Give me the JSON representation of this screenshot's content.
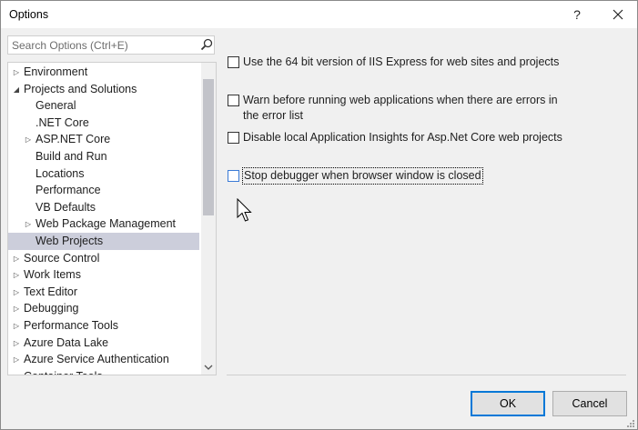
{
  "window": {
    "title": "Options",
    "help_label": "?"
  },
  "search": {
    "placeholder": "Search Options (Ctrl+E)"
  },
  "tree": {
    "items": [
      {
        "label": "Environment",
        "expander": "collapsed",
        "level": 0,
        "selected": false
      },
      {
        "label": "Projects and Solutions",
        "expander": "expanded",
        "level": 0,
        "selected": false
      },
      {
        "label": "General",
        "expander": "none",
        "level": 1,
        "selected": false
      },
      {
        "label": ".NET Core",
        "expander": "none",
        "level": 1,
        "selected": false
      },
      {
        "label": "ASP.NET Core",
        "expander": "collapsed",
        "level": 1,
        "selected": false
      },
      {
        "label": "Build and Run",
        "expander": "none",
        "level": 1,
        "selected": false
      },
      {
        "label": "Locations",
        "expander": "none",
        "level": 1,
        "selected": false
      },
      {
        "label": "Performance",
        "expander": "none",
        "level": 1,
        "selected": false
      },
      {
        "label": "VB Defaults",
        "expander": "none",
        "level": 1,
        "selected": false
      },
      {
        "label": "Web Package Management",
        "expander": "collapsed",
        "level": 1,
        "selected": false
      },
      {
        "label": "Web Projects",
        "expander": "none",
        "level": 1,
        "selected": true
      },
      {
        "label": "Source Control",
        "expander": "collapsed",
        "level": 0,
        "selected": false
      },
      {
        "label": "Work Items",
        "expander": "collapsed",
        "level": 0,
        "selected": false
      },
      {
        "label": "Text Editor",
        "expander": "collapsed",
        "level": 0,
        "selected": false
      },
      {
        "label": "Debugging",
        "expander": "collapsed",
        "level": 0,
        "selected": false
      },
      {
        "label": "Performance Tools",
        "expander": "collapsed",
        "level": 0,
        "selected": false
      },
      {
        "label": "Azure Data Lake",
        "expander": "collapsed",
        "level": 0,
        "selected": false
      },
      {
        "label": "Azure Service Authentication",
        "expander": "collapsed",
        "level": 0,
        "selected": false
      },
      {
        "label": "Container Tools",
        "expander": "collapsed",
        "level": 0,
        "selected": false
      }
    ]
  },
  "options": [
    {
      "label": "Use the 64 bit version of IIS Express for web sites and projects",
      "checked": false
    },
    {
      "label": "Warn before running web applications when there are errors in the error list",
      "checked": false
    },
    {
      "label": "Disable local Application Insights for Asp.Net Core web projects",
      "checked": false
    },
    {
      "label": "Stop debugger when browser window is closed",
      "checked": false,
      "focused": true
    }
  ],
  "buttons": {
    "ok": "OK",
    "cancel": "Cancel"
  },
  "colors": {
    "selection": "#cccedb",
    "focus_accent": "#0078d7",
    "scroll_thumb": "#c2c3c9"
  }
}
